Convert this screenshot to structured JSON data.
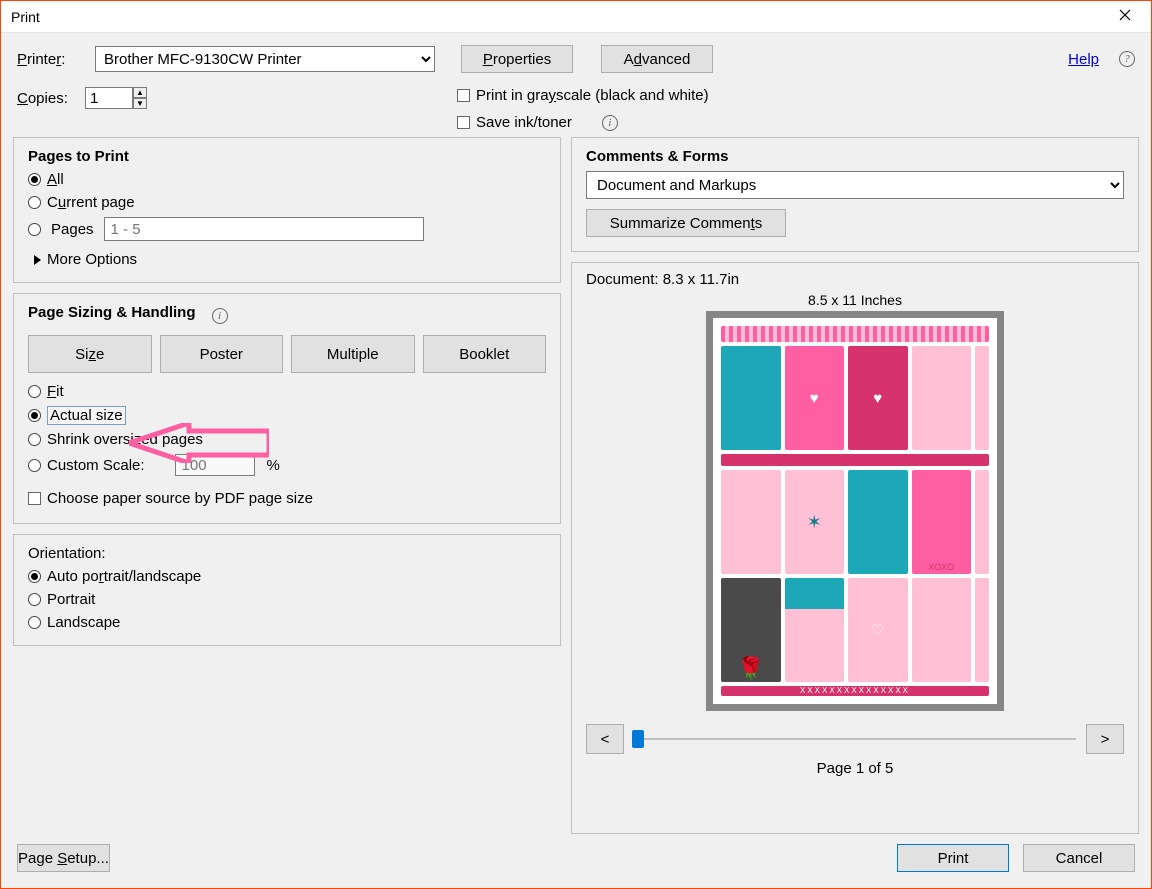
{
  "window": {
    "title": "Print"
  },
  "help": "Help",
  "printer": {
    "label": "Printer:",
    "selected": "Brother MFC-9130CW Printer",
    "properties": "Properties",
    "advanced": "Advanced"
  },
  "copies": {
    "label": "Copies:",
    "value": "1"
  },
  "options": {
    "grayscale": "Print in grayscale (black and white)",
    "saveInk": "Save ink/toner"
  },
  "pagesGroup": {
    "title": "Pages to Print",
    "all": "All",
    "current": "Current page",
    "pages": "Pages",
    "pagesPlaceholder": "1 - 5",
    "more": "More Options"
  },
  "sizing": {
    "title": "Page Sizing & Handling",
    "tabs": {
      "size": "Size",
      "poster": "Poster",
      "multiple": "Multiple",
      "booklet": "Booklet"
    },
    "fit": "Fit",
    "actual": "Actual size",
    "shrink": "Shrink oversized pages",
    "custom": "Custom Scale:",
    "customValue": "100",
    "customUnit": "%",
    "paperSource": "Choose paper source by PDF page size"
  },
  "orientation": {
    "title": "Orientation:",
    "auto": "Auto portrait/landscape",
    "portrait": "Portrait",
    "landscape": "Landscape"
  },
  "comments": {
    "title": "Comments & Forms",
    "selected": "Document and Markups",
    "summarize": "Summarize Comments"
  },
  "preview": {
    "docSize": "Document: 8.3 x 11.7in",
    "paperSize": "8.5 x 11 Inches",
    "prev": "<",
    "next": ">",
    "pageIndicator": "Page 1 of 5"
  },
  "footer": {
    "pageSetup": "Page Setup...",
    "print": "Print",
    "cancel": "Cancel"
  },
  "colors": {
    "pink": "#ff5fa2",
    "lightpink": "#ffc0d6",
    "hotpink": "#e91e63",
    "teal": "#17a2b8",
    "darkteal": "#0e7d8a",
    "darkpink": "#d6336c",
    "grey": "#4a4a4a",
    "white": "#ffffff"
  }
}
